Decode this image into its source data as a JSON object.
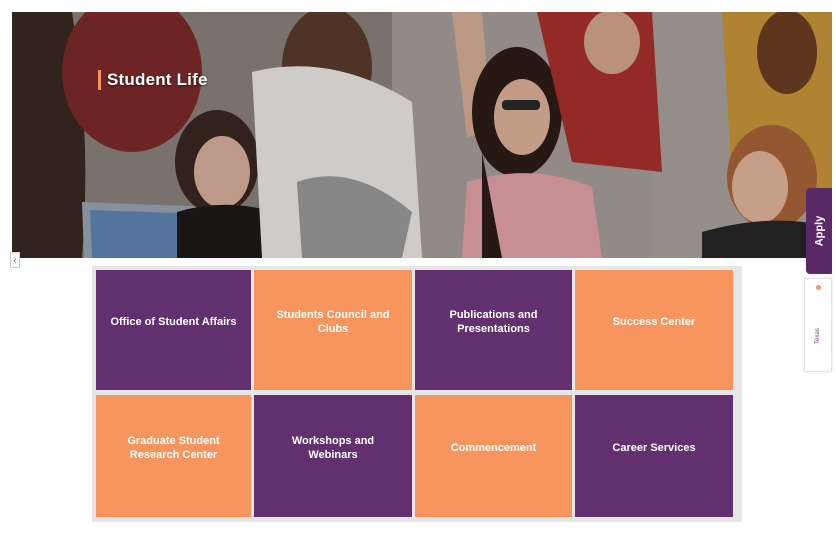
{
  "hero": {
    "title": "Student Life"
  },
  "tiles": [
    {
      "label": "Office of Student Affairs",
      "color": "#62306e"
    },
    {
      "label": "Students Council and Clubs",
      "color": "#f8955e"
    },
    {
      "label": "Publications and Presentations",
      "color": "#62306e"
    },
    {
      "label": "Success Center",
      "color": "#f8955e"
    },
    {
      "label": "Graduate Student Research Center",
      "color": "#f8955e"
    },
    {
      "label": "Workshops and Webinars",
      "color": "#62306e"
    },
    {
      "label": "Commencement",
      "color": "#f8955e"
    },
    {
      "label": "Career Services",
      "color": "#62306e"
    }
  ],
  "side": {
    "apply_label": "Apply",
    "logo_text": "Texas"
  },
  "colors": {
    "purple": "#62306e",
    "orange": "#f8955e",
    "apply_tab": "#5a2a66"
  },
  "icons": {
    "left_arrow": "chevron-left-icon"
  }
}
